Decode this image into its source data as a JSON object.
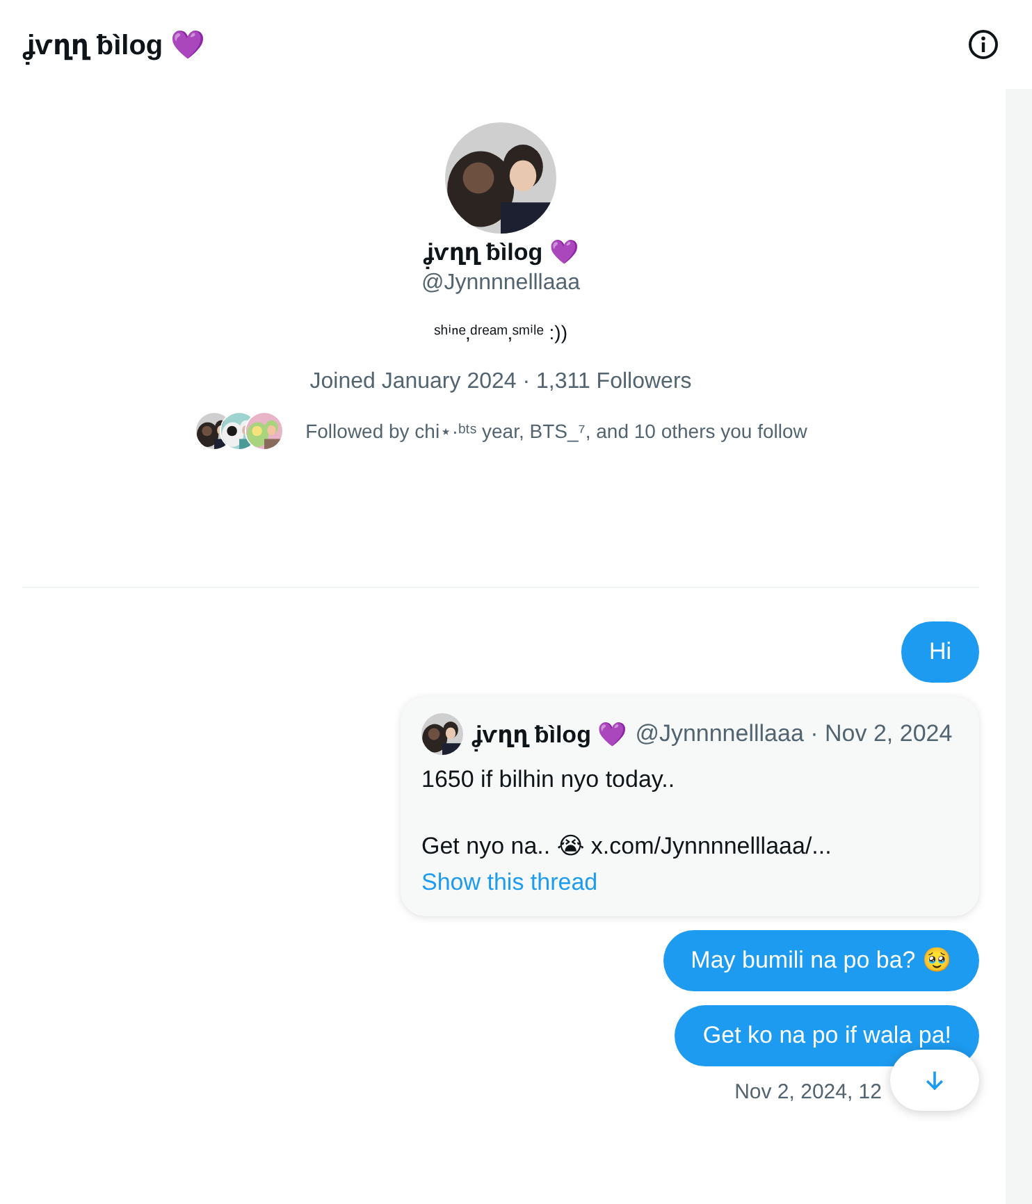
{
  "header": {
    "title": "ʝ̣ѵղղ ƀìlog 💜"
  },
  "profile": {
    "name": "ʝ̣ѵղղ ƀìlog 💜",
    "handle": "@Jynnnnelllaaa",
    "bio": "ˢʰⁱⁿᵉ‚ᵈʳᵉᵃᵐ‚ˢᵐⁱˡᵉ :))",
    "joined": "Joined January 2024 · 1,311 Followers",
    "followed_by": "Followed by chi⋆·ᵇᵗˢ year, BTS_⁷, and 10 others you follow"
  },
  "messages": [
    {
      "kind": "text",
      "text": "Hi"
    },
    {
      "kind": "quote",
      "name": "ʝ̣ѵղղ ƀìlog 💜",
      "meta": "@Jynnnnelllaaa · Nov 2, 2024",
      "lines": [
        "1650 if bilhin nyo today..",
        "Get nyo na.. 😭 x.com/Jynnnnelllaaa/..."
      ],
      "link": "Show this thread"
    },
    {
      "kind": "text",
      "text": "May bumili na po ba? 🥹"
    },
    {
      "kind": "text",
      "text": "Get ko na po if wala pa!"
    }
  ],
  "timestamp": "Nov 2, 2024, 12"
}
